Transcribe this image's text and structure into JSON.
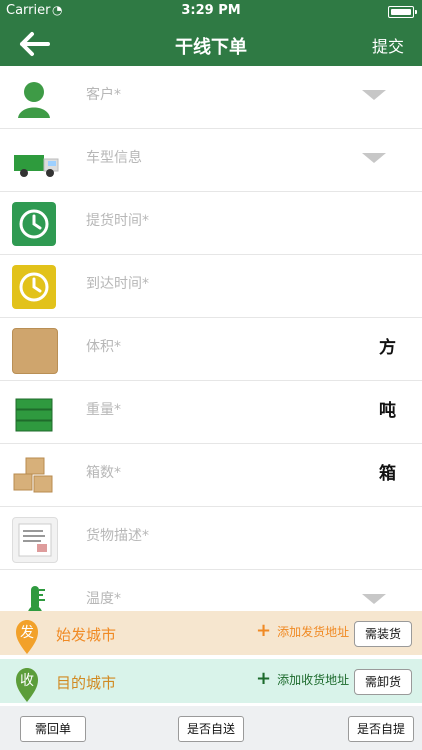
{
  "status_bar": {
    "carrier": "Carrier",
    "time": "3:29 PM"
  },
  "nav": {
    "title": "干线下单",
    "right_action": "提交",
    "back_icon": "back-arrow-icon"
  },
  "rows": [
    {
      "label": "客户*",
      "icon": "person-icon",
      "control": "dropdown"
    },
    {
      "label": "车型信息",
      "icon": "truck-icon",
      "control": "dropdown"
    },
    {
      "label": "提货时间*",
      "icon": "clock-icon",
      "control": "none"
    },
    {
      "label": "到达时间*",
      "icon": "clock-icon",
      "control": "none"
    },
    {
      "label": "体积*",
      "icon": "box-icon",
      "unit": "方"
    },
    {
      "label": "重量*",
      "icon": "crate-icon",
      "unit": "吨"
    },
    {
      "label": "箱数*",
      "icon": "boxes-icon",
      "unit": "箱"
    },
    {
      "label": "货物描述*",
      "icon": "document-icon",
      "control": "none"
    },
    {
      "label": "温度*",
      "icon": "thermometer-icon",
      "control": "dropdown"
    }
  ],
  "origin": {
    "badge": "发",
    "label": "始发城市",
    "add": "添加发货地址",
    "option": "需装货"
  },
  "destination": {
    "badge": "收",
    "label": "目的城市",
    "add": "添加收货地址",
    "option": "需卸货"
  },
  "bottom": {
    "b1": "需回单",
    "b2": "是否自送",
    "b3": "是否自提"
  },
  "colors": {
    "nav_green": "#2f7a44",
    "origin_bg": "#f6e6cf",
    "destination_bg": "#d9f3ea",
    "origin_accent": "#f08a24",
    "destination_accent": "#1c6a2c"
  }
}
